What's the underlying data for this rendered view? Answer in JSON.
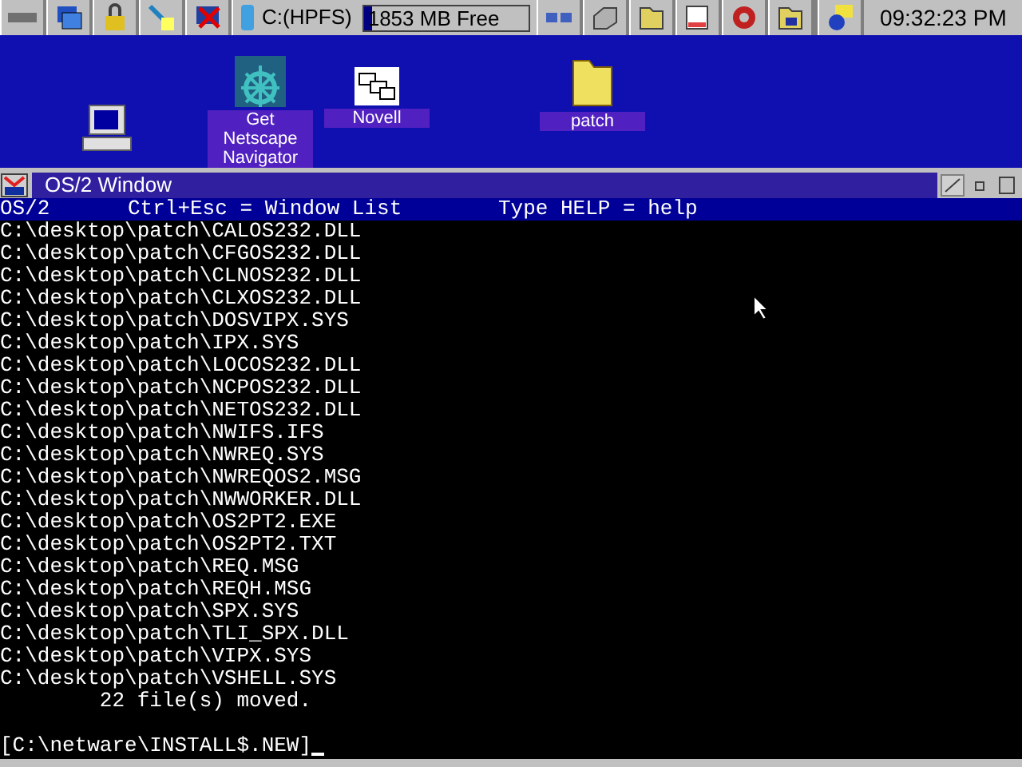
{
  "taskbar": {
    "drive": "C:(HPFS)",
    "free_space": {
      "text": "1853 MB Free",
      "level": 0.05
    },
    "clock": "09:32:23 PM"
  },
  "desktop_icons": [
    {
      "kind": "computer"
    },
    {
      "kind": "netscape",
      "label": "Get Netscape Navigator"
    },
    {
      "kind": "novell",
      "label": "Novell"
    },
    {
      "kind": "folder",
      "label": "patch"
    }
  ],
  "window": {
    "title": "OS/2 Window",
    "header": [
      "OS/2",
      "Ctrl+Esc = Window List",
      "Type HELP = help"
    ],
    "lines": [
      "C:\\desktop\\patch\\CALOS232.DLL",
      "C:\\desktop\\patch\\CFGOS232.DLL",
      "C:\\desktop\\patch\\CLNOS232.DLL",
      "C:\\desktop\\patch\\CLXOS232.DLL",
      "C:\\desktop\\patch\\DOSVIPX.SYS",
      "C:\\desktop\\patch\\IPX.SYS",
      "C:\\desktop\\patch\\LOCOS232.DLL",
      "C:\\desktop\\patch\\NCPOS232.DLL",
      "C:\\desktop\\patch\\NETOS232.DLL",
      "C:\\desktop\\patch\\NWIFS.IFS",
      "C:\\desktop\\patch\\NWREQ.SYS",
      "C:\\desktop\\patch\\NWREQOS2.MSG",
      "C:\\desktop\\patch\\NWWORKER.DLL",
      "C:\\desktop\\patch\\OS2PT2.EXE",
      "C:\\desktop\\patch\\OS2PT2.TXT",
      "C:\\desktop\\patch\\REQ.MSG",
      "C:\\desktop\\patch\\REQH.MSG",
      "C:\\desktop\\patch\\SPX.SYS",
      "C:\\desktop\\patch\\TLI_SPX.DLL",
      "C:\\desktop\\patch\\VIPX.SYS",
      "C:\\desktop\\patch\\VSHELL.SYS",
      "        22 file(s) moved."
    ],
    "prompt": "[C:\\netware\\INSTALL$.NEW]"
  }
}
